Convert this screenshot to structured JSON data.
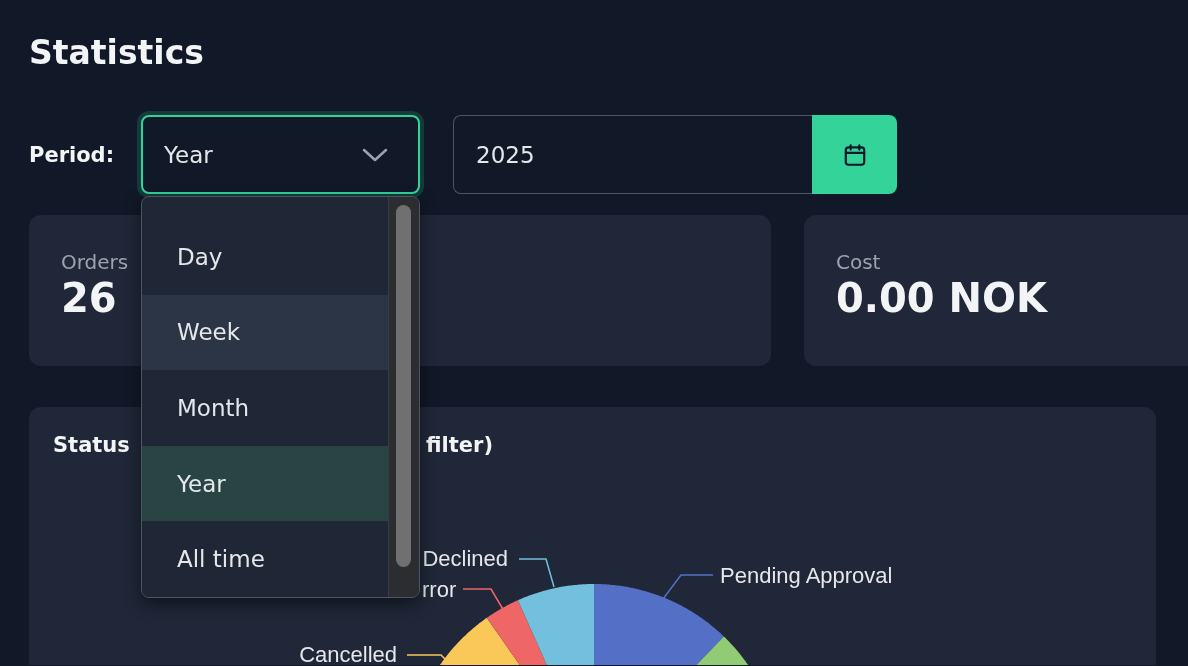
{
  "page": {
    "title": "Statistics"
  },
  "period": {
    "label": "Period:",
    "select": {
      "value": "Year",
      "open": true
    },
    "year_field": {
      "value": "2025"
    }
  },
  "period_options": [
    {
      "label": "Day",
      "selected": false,
      "highlighted": false
    },
    {
      "label": "Week",
      "selected": false,
      "highlighted": true
    },
    {
      "label": "Month",
      "selected": false,
      "highlighted": false
    },
    {
      "label": "Year",
      "selected": true,
      "highlighted": false
    },
    {
      "label": "All time",
      "selected": false,
      "highlighted": false
    }
  ],
  "stat_cards": [
    {
      "label": "Orders",
      "value": "26"
    },
    {
      "label": "Cost",
      "value": "0.00 NOK"
    }
  ],
  "status_chart": {
    "title_start": "Status",
    "title_end": "filter)",
    "slice_labels": [
      {
        "label": "Declined",
        "color": "#73c0de"
      },
      {
        "label": "rror",
        "color": "#ee6666"
      },
      {
        "label": "Pending Approval",
        "color": "#5470c6"
      },
      {
        "label": "Cancelled",
        "color": "#fac858"
      }
    ]
  }
}
